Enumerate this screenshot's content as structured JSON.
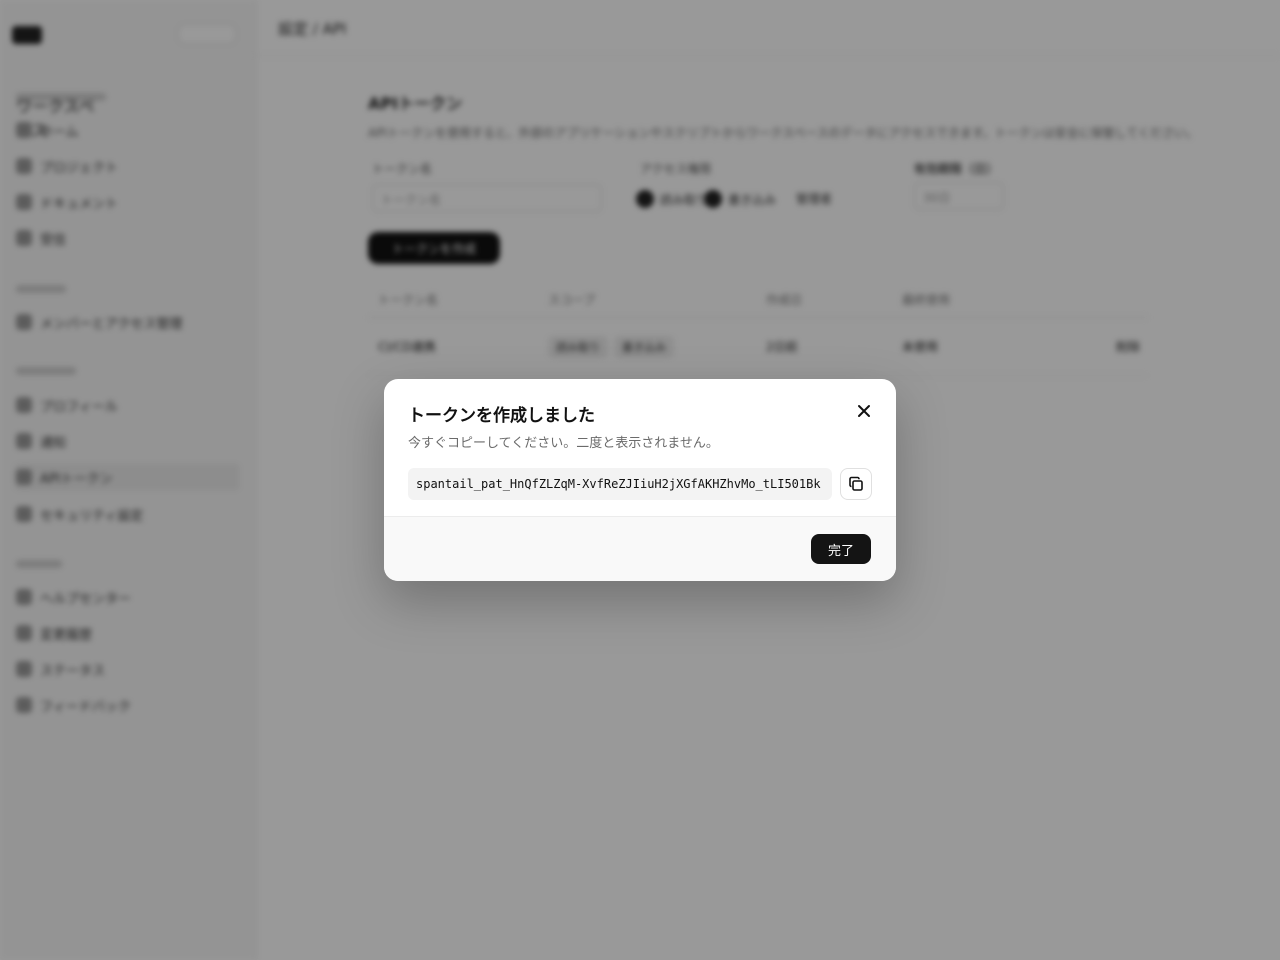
{
  "background": {
    "breadcrumb": "設定 / API",
    "sidebar": {
      "sections": [
        {
          "label": "ワークスペース",
          "items": [
            "ホーム",
            "プロジェクト",
            "ドキュメント",
            "受信"
          ]
        },
        {
          "label": "チーム",
          "items": [
            "メンバーとアクセス管理"
          ]
        },
        {
          "label": "アカウント",
          "items": [
            "プロフィール",
            "通知",
            "APIトークン",
            "セキュリティ設定"
          ]
        },
        {
          "label": "その他",
          "items": [
            "ヘルプセンター",
            "変更履歴",
            "ステータス",
            "フィードバック"
          ]
        }
      ],
      "active_item": "APIトークン"
    },
    "page": {
      "heading": "APIトークン",
      "description": "APIトークンを使用すると、外部のアプリケーションやスクリプトからワークスペースのデータにアクセスできます。トークンは安全に保管してください。",
      "form": {
        "name_label": "トークン名",
        "name_placeholder": "トークン名",
        "scope_label": "アクセス権限",
        "scope_options": [
          "読み取り",
          "書き込み",
          "管理者"
        ],
        "expiry_label": "有効期限（日）",
        "expiry_value": "30日"
      },
      "create_button": "トークンを作成",
      "table": {
        "headers": [
          "トークン名",
          "スコープ",
          "作成日",
          "最終使用",
          ""
        ],
        "rows": [
          {
            "name": "CI/CD連携",
            "scopes": [
              "読み取り",
              "書き込み"
            ],
            "created": "2日前",
            "last_used": "未使用",
            "action": "削除"
          }
        ]
      }
    }
  },
  "dialog": {
    "title": "トークンを作成しました",
    "subtitle": "今すぐコピーしてください。二度と表示されません。",
    "token": "spantail_pat_HnQfZLZqM-XvfReZJIiuH2jXGfAKHZhvMo_tLI501Bk",
    "done_label": "完了",
    "close_icon": "close-icon",
    "copy_icon": "copy-icon"
  }
}
